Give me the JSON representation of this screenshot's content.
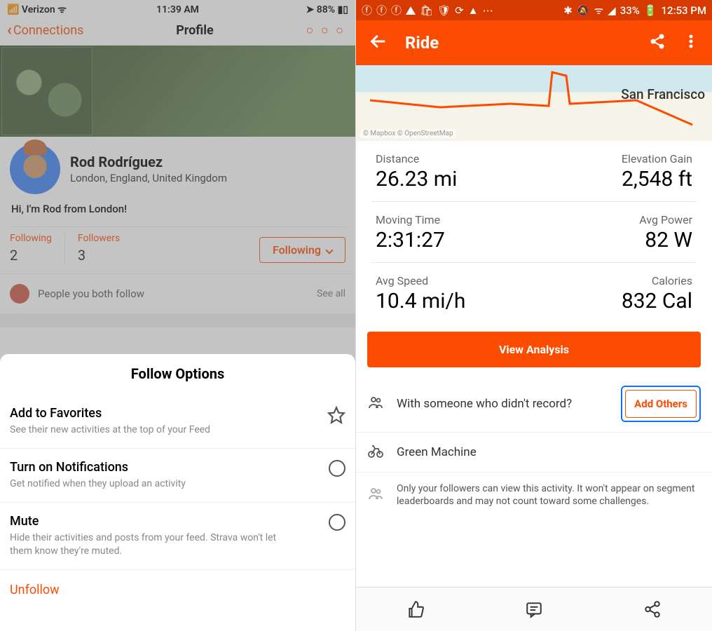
{
  "left": {
    "status": {
      "carrier": "Verizon",
      "time": "11:39 AM",
      "battery": "88%"
    },
    "nav": {
      "back": "Connections",
      "title": "Profile"
    },
    "profile": {
      "name": "Rod Rodríguez",
      "location": "London, England, United Kingdom",
      "bio": "Hi, I'm Rod from London!",
      "following_label": "Following",
      "following_count": "2",
      "followers_label": "Followers",
      "followers_count": "3",
      "following_btn": "Following",
      "mutual": "People you both follow",
      "see_all": "See all"
    },
    "sheet": {
      "title": "Follow Options",
      "fav_title": "Add to Favorites",
      "fav_sub": "See their new activities at the top of your Feed",
      "notif_title": "Turn on Notifications",
      "notif_sub": "Get notified when they upload an activity",
      "mute_title": "Mute",
      "mute_sub": "Hide their activities and posts from your feed. Strava won't let them know they're muted.",
      "unfollow": "Unfollow"
    }
  },
  "right": {
    "status": {
      "pct": "33%",
      "time": "12:53 PM"
    },
    "nav": {
      "title": "Ride"
    },
    "map": {
      "city": "San Francisco",
      "credit": "© Mapbox © OpenStreetMap"
    },
    "stats": {
      "distance_label": "Distance",
      "distance_val": "26.23 mi",
      "elev_label": "Elevation Gain",
      "elev_val": "2,548 ft",
      "time_label": "Moving Time",
      "time_val": "2:31:27",
      "power_label": "Avg Power",
      "power_val": "82 W",
      "speed_label": "Avg Speed",
      "speed_val": "10.4 mi/h",
      "cal_label": "Calories",
      "cal_val": "832 Cal"
    },
    "view_analysis": "View Analysis",
    "with_someone": "With someone who didn't record?",
    "add_others": "Add Others",
    "gear": "Green Machine",
    "privacy": "Only your followers can view this activity. It won't appear on segment leaderboards and may not count toward some challenges."
  }
}
